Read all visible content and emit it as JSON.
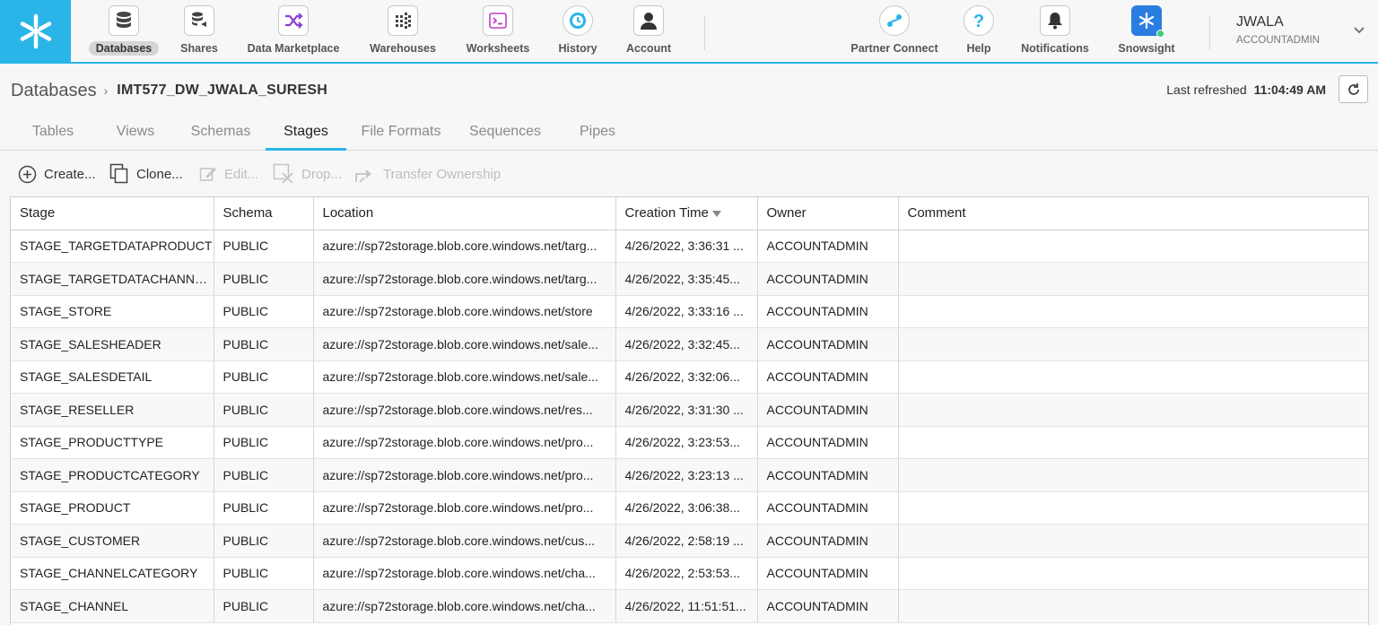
{
  "nav": {
    "items": [
      {
        "label": "Databases",
        "icon": "database-icon"
      },
      {
        "label": "Shares",
        "icon": "share-icon"
      },
      {
        "label": "Data Marketplace",
        "icon": "marketplace-icon"
      },
      {
        "label": "Warehouses",
        "icon": "warehouse-icon"
      },
      {
        "label": "Worksheets",
        "icon": "terminal-icon"
      },
      {
        "label": "History",
        "icon": "history-icon"
      },
      {
        "label": "Account",
        "icon": "account-icon"
      }
    ],
    "right_items": [
      {
        "label": "Partner Connect",
        "icon": "partner-connect-icon"
      },
      {
        "label": "Help",
        "icon": "help-icon"
      },
      {
        "label": "Notifications",
        "icon": "bell-icon"
      },
      {
        "label": "Snowsight",
        "icon": "snowsight-icon"
      }
    ],
    "active": "Databases"
  },
  "user": {
    "name": "JWALA",
    "role": "ACCOUNTADMIN"
  },
  "breadcrumb": {
    "root": "Databases",
    "separator": "›",
    "database": "IMT577_DW_JWALA_SURESH"
  },
  "refresh": {
    "label": "Last refreshed",
    "time": "11:04:49 AM"
  },
  "tabs": {
    "items": [
      "Tables",
      "Views",
      "Schemas",
      "Stages",
      "File Formats",
      "Sequences",
      "Pipes"
    ],
    "active": "Stages"
  },
  "toolbar": {
    "create": "Create...",
    "clone": "Clone...",
    "edit": "Edit...",
    "drop": "Drop...",
    "transfer": "Transfer Ownership"
  },
  "table": {
    "columns": [
      "Stage",
      "Schema",
      "Location",
      "Creation Time",
      "Owner",
      "Comment"
    ],
    "sorted_column": "Creation Time",
    "rows": [
      [
        "STAGE_TARGETDATAPRODUCT",
        "PUBLIC",
        "azure://sp72storage.blob.core.windows.net/targ...",
        "4/26/2022, 3:36:31 ...",
        "ACCOUNTADMIN",
        ""
      ],
      [
        "STAGE_TARGETDATACHANNE...",
        "PUBLIC",
        "azure://sp72storage.blob.core.windows.net/targ...",
        "4/26/2022, 3:35:45...",
        "ACCOUNTADMIN",
        ""
      ],
      [
        "STAGE_STORE",
        "PUBLIC",
        "azure://sp72storage.blob.core.windows.net/store",
        "4/26/2022, 3:33:16 ...",
        "ACCOUNTADMIN",
        ""
      ],
      [
        "STAGE_SALESHEADER",
        "PUBLIC",
        "azure://sp72storage.blob.core.windows.net/sale...",
        "4/26/2022, 3:32:45...",
        "ACCOUNTADMIN",
        ""
      ],
      [
        "STAGE_SALESDETAIL",
        "PUBLIC",
        "azure://sp72storage.blob.core.windows.net/sale...",
        "4/26/2022, 3:32:06...",
        "ACCOUNTADMIN",
        ""
      ],
      [
        "STAGE_RESELLER",
        "PUBLIC",
        "azure://sp72storage.blob.core.windows.net/res...",
        "4/26/2022, 3:31:30 ...",
        "ACCOUNTADMIN",
        ""
      ],
      [
        "STAGE_PRODUCTTYPE",
        "PUBLIC",
        "azure://sp72storage.blob.core.windows.net/pro...",
        "4/26/2022, 3:23:53...",
        "ACCOUNTADMIN",
        ""
      ],
      [
        "STAGE_PRODUCTCATEGORY",
        "PUBLIC",
        "azure://sp72storage.blob.core.windows.net/pro...",
        "4/26/2022, 3:23:13 ...",
        "ACCOUNTADMIN",
        ""
      ],
      [
        "STAGE_PRODUCT",
        "PUBLIC",
        "azure://sp72storage.blob.core.windows.net/pro...",
        "4/26/2022, 3:06:38...",
        "ACCOUNTADMIN",
        ""
      ],
      [
        "STAGE_CUSTOMER",
        "PUBLIC",
        "azure://sp72storage.blob.core.windows.net/cus...",
        "4/26/2022, 2:58:19 ...",
        "ACCOUNTADMIN",
        ""
      ],
      [
        "STAGE_CHANNELCATEGORY",
        "PUBLIC",
        "azure://sp72storage.blob.core.windows.net/cha...",
        "4/26/2022, 2:53:53...",
        "ACCOUNTADMIN",
        ""
      ],
      [
        "STAGE_CHANNEL",
        "PUBLIC",
        "azure://sp72storage.blob.core.windows.net/cha...",
        "4/26/2022, 11:51:51...",
        "ACCOUNTADMIN",
        ""
      ]
    ]
  },
  "colors": {
    "accent": "#29b5e8",
    "disabled": "#bdbdbd"
  }
}
